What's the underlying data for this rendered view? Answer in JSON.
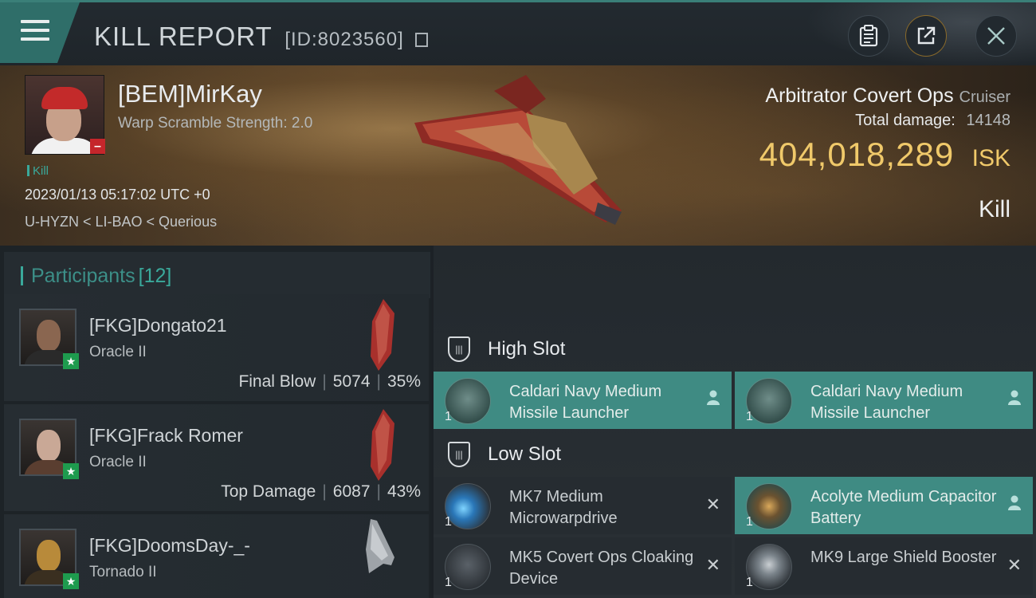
{
  "header": {
    "title": "KILL REPORT",
    "report_id": "[ID:8023560]"
  },
  "victim": {
    "name": "[BEM]MirKay",
    "warp_scramble": "Warp Scramble Strength: 2.0",
    "kill_tag": "Kill",
    "timestamp": "2023/01/13 05:17:02 UTC +0",
    "location": "U-HYZN < LI-BAO < Querious",
    "ship_name": "Arbitrator Covert Ops",
    "ship_class": "Cruiser",
    "total_damage_label": "Total damage:",
    "total_damage": "14148",
    "isk_value": "404,018,289",
    "isk_unit": "ISK",
    "result": "Kill"
  },
  "participants": {
    "label": "Participants",
    "count": "[12]",
    "rows": [
      {
        "name": "[FKG]Dongato21",
        "ship": "Oracle II",
        "role": "Final Blow",
        "damage": "5074",
        "percent": "35%"
      },
      {
        "name": "[FKG]Frack Romer",
        "ship": "Oracle II",
        "role": "Top Damage",
        "damage": "6087",
        "percent": "43%"
      },
      {
        "name": "[FKG]DoomsDay-_-",
        "ship": "Tornado II"
      }
    ]
  },
  "fitting": {
    "high_slot": {
      "title": "High Slot",
      "modules": [
        {
          "name": "Caldari Navy Medium Missile Launcher",
          "qty": "1",
          "state": "dropped"
        },
        {
          "name": "Caldari Navy Medium Missile Launcher",
          "qty": "1",
          "state": "dropped"
        }
      ]
    },
    "low_slot": {
      "title": "Low Slot",
      "modules": [
        {
          "name": "MK7 Medium Microwarpdrive",
          "qty": "1",
          "state": "destroyed"
        },
        {
          "name": "Acolyte Medium Capacitor Battery",
          "qty": "1",
          "state": "dropped"
        },
        {
          "name": "MK5 Covert Ops Cloaking Device",
          "qty": "1",
          "state": "destroyed"
        },
        {
          "name": "MK9 Large Shield Booster",
          "qty": "1",
          "state": "destroyed"
        }
      ]
    }
  },
  "colors": {
    "accent_teal": "#3aa99b",
    "highlight_row": "#3f8b83",
    "isk_gold": "#f0c96a",
    "minus_badge": "#c5262b",
    "star_badge": "#1e9b4e"
  },
  "icons": {
    "menu": "hamburger-icon",
    "copy": "copy-icon",
    "clipboard": "clipboard-icon",
    "share": "share-icon",
    "close": "close-icon",
    "slot": "shield-slot-icon",
    "dropped": "person-icon",
    "destroyed": "x-icon"
  }
}
